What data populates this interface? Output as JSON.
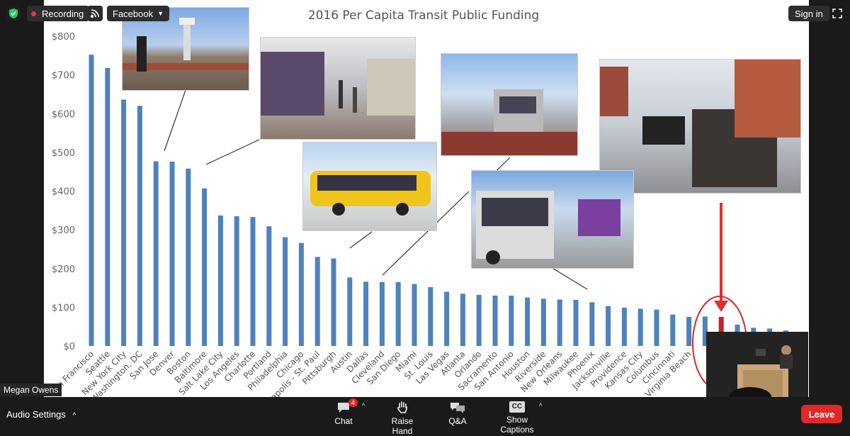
{
  "topbar": {
    "recording_label": "Recording",
    "facebook_label": "Facebook",
    "signin_label": "Sign in"
  },
  "participant": {
    "name": "Megan Owens"
  },
  "bottombar": {
    "audio_settings_label": "Audio Settings",
    "chat_label": "Chat",
    "chat_badge": "4",
    "raise_hand_label": "Raise Hand",
    "qa_label": "Q&A",
    "captions_label": "Show Captions",
    "captions_icon_text": "CC",
    "leave_label": "Leave"
  },
  "colors": {
    "bar": "#4f81bd",
    "highlight_bar": "#cc1f2b",
    "leave": "#e02828",
    "recording_dot": "#e8373a"
  },
  "chart_data": {
    "type": "bar",
    "title": "2016 Per Capita Transit Public Funding",
    "xlabel": "",
    "ylabel": "",
    "ylim": [
      0,
      800
    ],
    "ytick_labels": [
      "$0",
      "$100",
      "$200",
      "$300",
      "$400",
      "$500",
      "$600",
      "$700",
      "$800"
    ],
    "categories": [
      "San Francisco",
      "Seattle",
      "New York City",
      "Washington, DC",
      "San Jose",
      "Denver",
      "Boston",
      "Baltimore",
      "Salt Lake City",
      "Los Angeles",
      "Charlotte",
      "Portland",
      "Philadelphia",
      "Chicago",
      "Minneapolis - St. Paul",
      "Pittsburgh",
      "Austin",
      "Dallas",
      "Cleveland",
      "San Diego",
      "Miami",
      "St. Louis",
      "Las Vegas",
      "Atlanta",
      "Orlando",
      "Sacramento",
      "San Antonio",
      "Houston",
      "Riverside",
      "New Orleans",
      "Milwaukee",
      "Phoenix",
      "Jacksonville",
      "Providence",
      "Kansas City",
      "Columbus",
      "Cincinnati",
      "Virginia Beach",
      "",
      "",
      "",
      "",
      "",
      ""
    ],
    "values": [
      752,
      718,
      636,
      620,
      477,
      476,
      458,
      407,
      337,
      335,
      333,
      309,
      281,
      266,
      230,
      226,
      177,
      166,
      165,
      165,
      160,
      152,
      140,
      135,
      132,
      130,
      130,
      125,
      122,
      120,
      119,
      113,
      103,
      99,
      96,
      94,
      81,
      75,
      76,
      75,
      55,
      47,
      45,
      40
    ],
    "highlight_index": 39,
    "grid": false
  }
}
